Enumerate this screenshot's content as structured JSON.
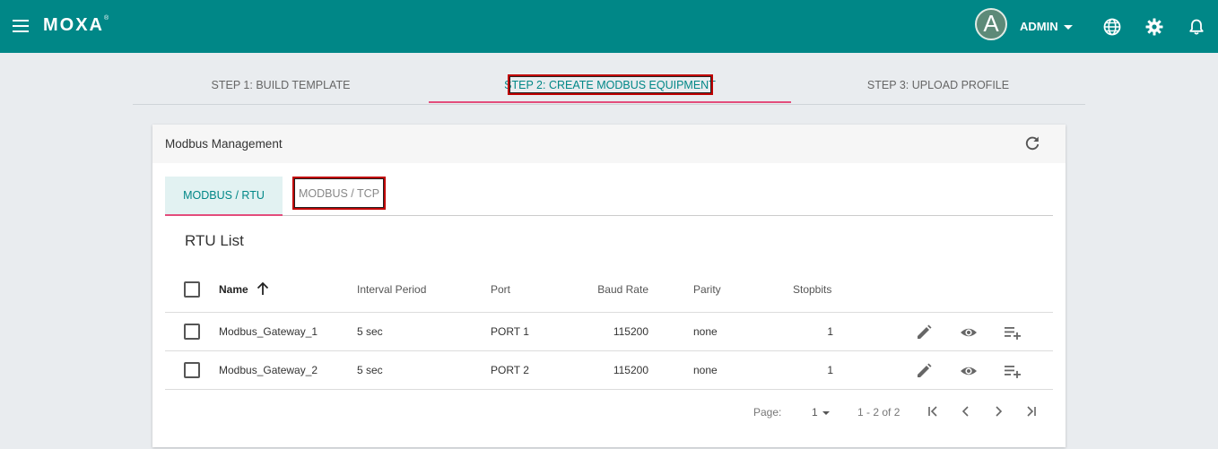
{
  "topbar": {
    "logo": "MOXA",
    "logo_mark": "®",
    "avatar_letter": "A",
    "user_label": "ADMIN",
    "icons": [
      "menu-icon",
      "globe-icon",
      "gear-icon",
      "bell-icon"
    ],
    "color": "#008787"
  },
  "steps": [
    {
      "label": "STEP 1: BUILD TEMPLATE",
      "active": false
    },
    {
      "label": "STEP 2: CREATE MODBUS EQUIPMENT",
      "active": true
    },
    {
      "label": "STEP 3: UPLOAD PROFILE",
      "active": false
    }
  ],
  "card": {
    "title": "Modbus Management",
    "tabs": [
      {
        "label": "MODBUS / RTU",
        "active": true
      },
      {
        "label": "MODBUS / TCP",
        "active": false
      }
    ],
    "list_title": "RTU List",
    "columns": [
      "Name",
      "Interval Period",
      "Port",
      "Baud Rate",
      "Parity",
      "Stopbits"
    ],
    "rows": [
      {
        "name": "Modbus_Gateway_1",
        "interval": "5 sec",
        "port": "PORT 1",
        "baud": "115200",
        "parity": "none",
        "stopbits": "1"
      },
      {
        "name": "Modbus_Gateway_2",
        "interval": "5 sec",
        "port": "PORT 2",
        "baud": "115200",
        "parity": "none",
        "stopbits": "1"
      }
    ],
    "row_actions": [
      "edit-icon",
      "eye-icon",
      "playlist-add-icon"
    ],
    "pagination": {
      "page_label": "Page:",
      "page_value": "1",
      "range": "1 - 2 of 2"
    }
  },
  "colors": {
    "accent": "#008787",
    "highlight": "#e34d7c",
    "annotation": "#c00000"
  }
}
